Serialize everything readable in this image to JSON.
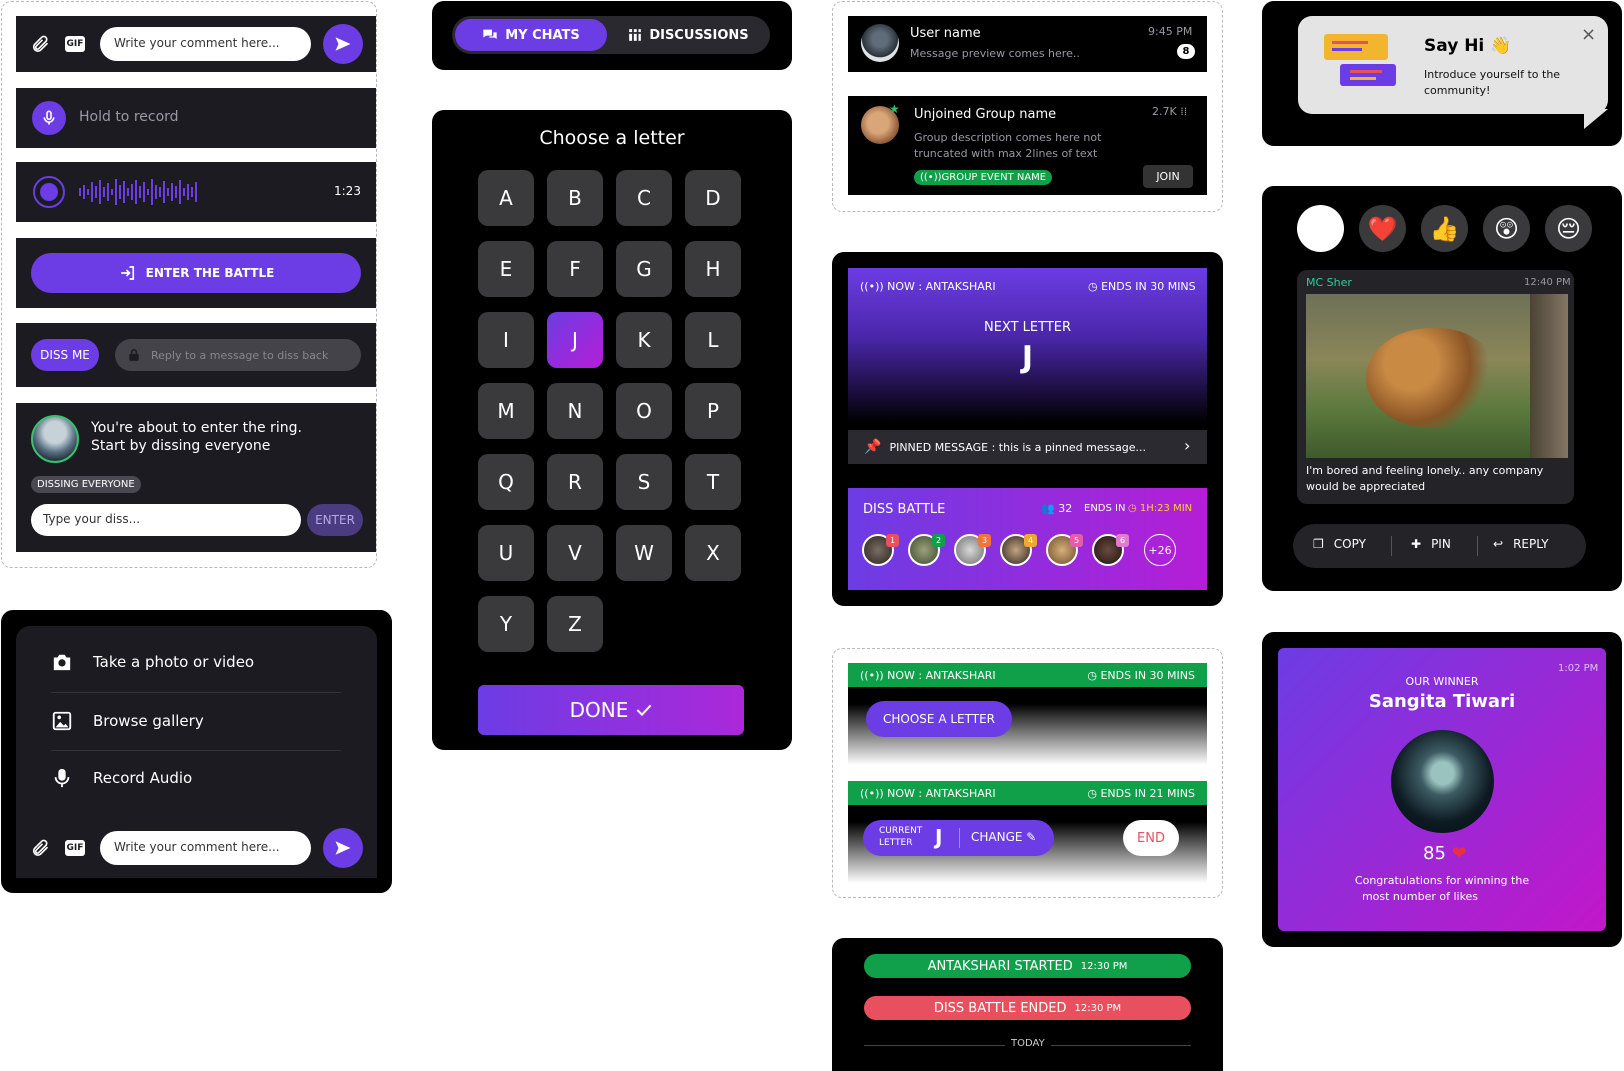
{
  "comment_bar": {
    "gif": "GIF",
    "placeholder": "Write your comment here..."
  },
  "record": {
    "hold_label": "Hold to record",
    "duration": "1:23"
  },
  "battle_button": {
    "label": "ENTER THE BATTLE"
  },
  "diss_row": {
    "diss_me": "DISS ME",
    "reply_placeholder": "Reply to a message to diss back"
  },
  "ring_card": {
    "line1": "You're about to enter the ring.",
    "line2": "Start by dissing everyone",
    "tag": "DISSING EVERYONE",
    "input_placeholder": "Type your diss...",
    "enter": "ENTER"
  },
  "attach_menu": {
    "items": [
      {
        "label": "Take a photo or video"
      },
      {
        "label": "Browse gallery"
      },
      {
        "label": "Record Audio"
      }
    ],
    "gif": "GIF",
    "placeholder": "Write your comment here..."
  },
  "tabs": {
    "my_chats": "MY CHATS",
    "discussions": "DISCUSSIONS"
  },
  "letter_picker": {
    "title": "Choose a letter",
    "letters": [
      "A",
      "B",
      "C",
      "D",
      "E",
      "F",
      "G",
      "H",
      "I",
      "J",
      "K",
      "L",
      "M",
      "N",
      "O",
      "P",
      "Q",
      "R",
      "S",
      "T",
      "U",
      "V",
      "W",
      "X",
      "Y",
      "Z"
    ],
    "selected": "J",
    "done": "DONE"
  },
  "chat_item": {
    "name": "User name",
    "preview": "Message preview comes here..",
    "time": "9:45 PM",
    "unread": "8"
  },
  "group_item": {
    "name": "Unjoined Group name",
    "desc_line1": "Group description comes here not",
    "desc_line2": "truncated with max 2lines of text",
    "event_tag": "GROUP EVENT NAME",
    "members": "2.7K",
    "join": "JOIN"
  },
  "antakshari_card": {
    "now": "NOW : ANTAKSHARI",
    "ends": "ENDS IN 30 MINS",
    "next_label": "NEXT LETTER",
    "letter": "J",
    "pinned": "PINNED MESSAGE : this is a pinned message...",
    "diss_title": "DISS BATTLE",
    "participants": "32",
    "ends_in_label": "ENDS IN",
    "ends_in_time": "1H:23 MIN",
    "ranks": [
      "1",
      "2",
      "3",
      "4",
      "5",
      "6"
    ],
    "more": "+26"
  },
  "host_cards": {
    "now": "NOW : ANTAKSHARI",
    "ends1": "ENDS IN 30 MINS",
    "choose": "CHOOSE  A LETTER",
    "ends2": "ENDS IN 21 MINS",
    "current_label_1": "CURRENT",
    "current_label_2": "LETTER",
    "current_letter": "J",
    "change": "CHANGE",
    "end": "END"
  },
  "events": {
    "started": "ANTAKSHARI STARTED",
    "started_time": "12:30 PM",
    "ended": "DISS BATTLE ENDED",
    "ended_time": "12:30 PM",
    "today": "TODAY"
  },
  "say_hi": {
    "title": "Say Hi",
    "text_line1": "Introduce yourself to the",
    "text_line2": "community!"
  },
  "reactions": {
    "emojis": [
      "😂",
      "❤️",
      "👍",
      "😲",
      "😔"
    ],
    "sender": "MC Sher",
    "time": "12:40 PM",
    "message_line1": "I'm bored and feeling lonely.. any company",
    "message_line2": "would be appreciated",
    "actions": [
      "COPY",
      "PIN",
      "REPLY"
    ]
  },
  "winner": {
    "time": "1:02 PM",
    "label": "OUR WINNER",
    "name": "Sangita Tiwari",
    "likes": "85",
    "congrats_line1": "Congratulations for winning the",
    "congrats_line2": "most number of likes"
  },
  "colors": {
    "purple": "#6c3ce4",
    "magenta": "#b51ed6",
    "green": "#11a04a",
    "red": "#e8505f",
    "card": "#1d1b22"
  }
}
